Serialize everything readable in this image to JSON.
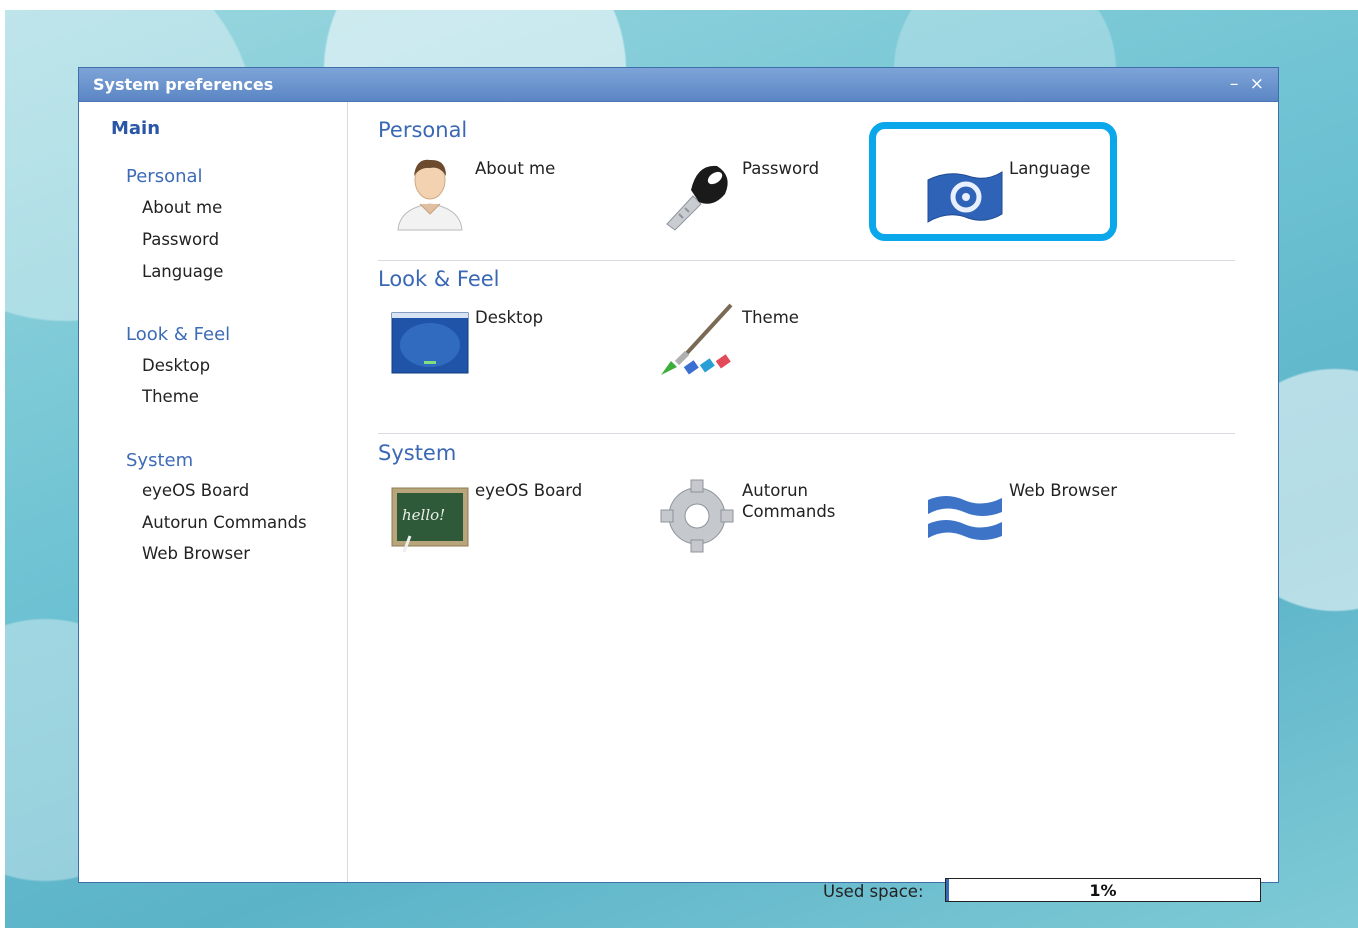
{
  "window": {
    "title": "System preferences",
    "minimize_glyph": "–",
    "close_glyph": "×"
  },
  "sidebar": {
    "main": "Main",
    "groups": [
      {
        "heading": "Personal",
        "items": [
          "About me",
          "Password",
          "Language"
        ]
      },
      {
        "heading": "Look & Feel",
        "items": [
          "Desktop",
          "Theme"
        ]
      },
      {
        "heading": "System",
        "items": [
          "eyeOS Board",
          "Autorun Commands",
          "Web Browser"
        ]
      }
    ]
  },
  "sections": {
    "personal": {
      "title": "Personal",
      "tiles": [
        {
          "label": "About me",
          "icon": "user-icon"
        },
        {
          "label": "Password",
          "icon": "key-icon"
        },
        {
          "label": "Language",
          "icon": "flag-icon"
        }
      ]
    },
    "look": {
      "title": "Look & Feel",
      "tiles": [
        {
          "label": "Desktop",
          "icon": "desktop-icon"
        },
        {
          "label": "Theme",
          "icon": "paintbrush-icon"
        }
      ]
    },
    "system": {
      "title": "System",
      "tiles": [
        {
          "label": "eyeOS Board",
          "icon": "chalkboard-icon"
        },
        {
          "label": "Autorun\nCommands",
          "icon": "gear-icon"
        },
        {
          "label": "Web Browser",
          "icon": "waves-icon"
        }
      ]
    }
  },
  "usage": {
    "label": "Used space:",
    "percent_text": "1%",
    "fraction": 0.01
  },
  "colors": {
    "accent": "#3b68b4",
    "titlebar": "#6b93cf",
    "highlight": "#0aa8ea"
  }
}
